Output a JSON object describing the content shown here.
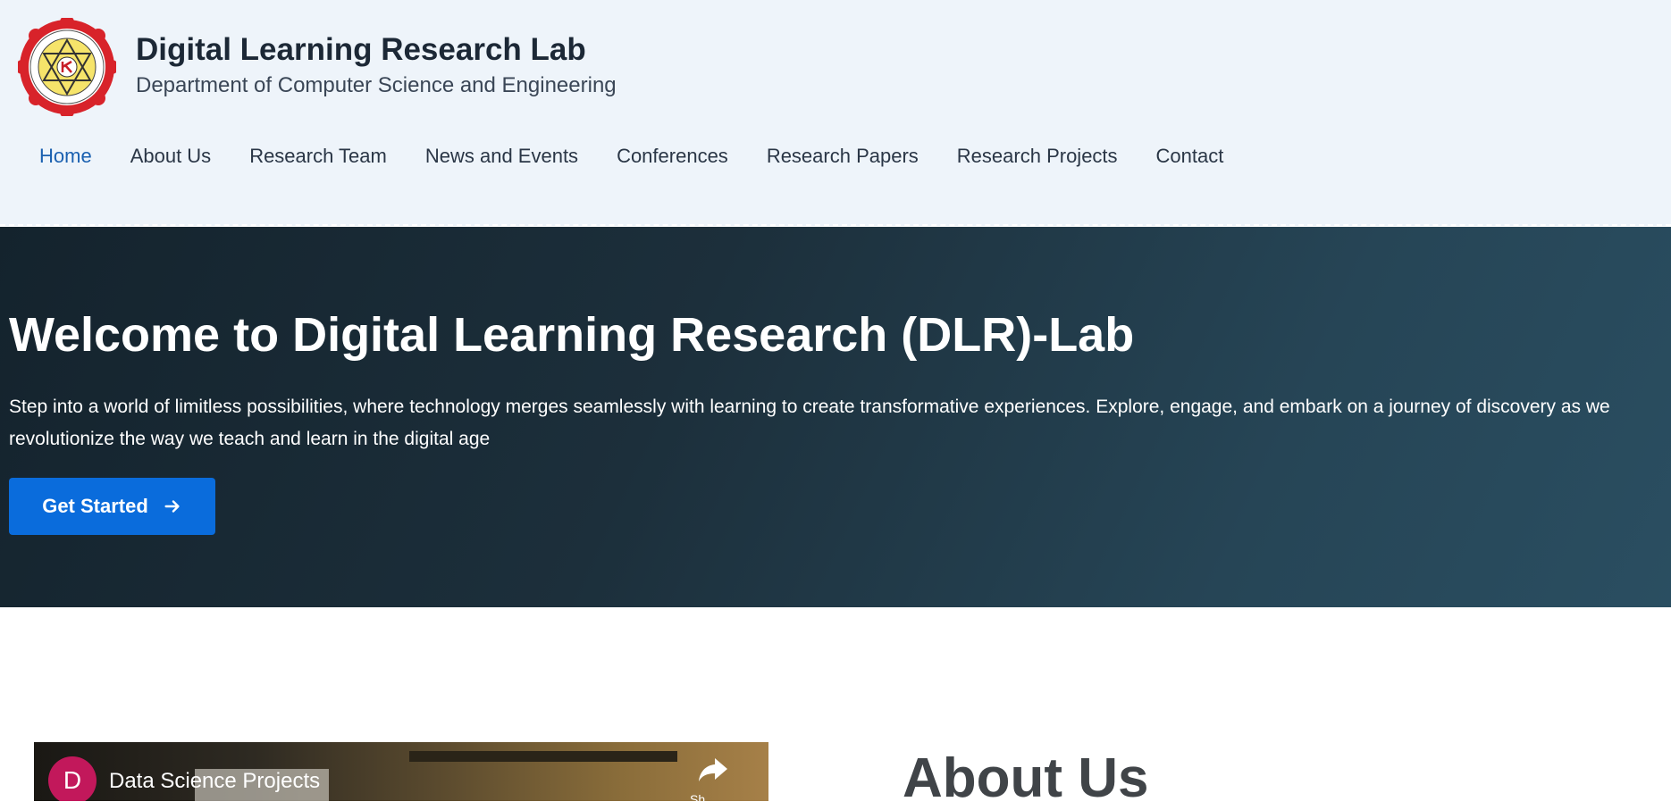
{
  "header": {
    "title": "Digital Learning Research Lab",
    "subtitle": "Department of Computer Science and Engineering",
    "nav": [
      {
        "label": "Home",
        "active": true
      },
      {
        "label": "About Us"
      },
      {
        "label": "Research Team"
      },
      {
        "label": "News and Events"
      },
      {
        "label": "Conferences"
      },
      {
        "label": "Research Papers"
      },
      {
        "label": "Research Projects"
      },
      {
        "label": "Contact"
      }
    ]
  },
  "hero": {
    "title": "Welcome to Digital Learning Research (DLR)-Lab",
    "text": "Step into a world of limitless possibilities, where technology merges seamlessly with learning to create transformative experiences. Explore, engage, and embark on a journey of discovery as we revolutionize the way we teach and learn in the digital age",
    "cta_label": "Get Started",
    "cta_icon": "arrow-right-icon"
  },
  "video": {
    "channel_initial": "D",
    "title": "Data Science Projects",
    "share_label": "Sh",
    "share_icon": "share-icon"
  },
  "about": {
    "heading": "About Us"
  },
  "colors": {
    "header_bg": "#eef4fa",
    "nav_active": "#1a60b0",
    "hero_bg_start": "#14232d",
    "hero_bg_end": "#2a4e61",
    "cta_bg": "#0a6cdc",
    "avatar_bg": "#c2185b"
  }
}
